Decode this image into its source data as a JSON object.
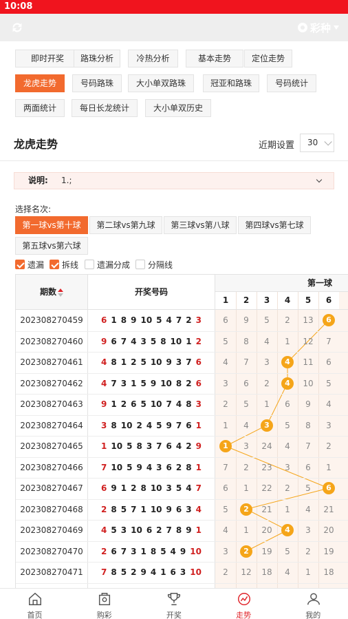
{
  "status": {
    "time": "10:08"
  },
  "header": {
    "lottery": "彩种"
  },
  "tabs": [
    {
      "label": "即时开奖",
      "active": false
    },
    {
      "label": "路珠分析",
      "active": false
    },
    {
      "label": "冷热分析",
      "active": false
    },
    {
      "label": "基本走势",
      "active": false
    },
    {
      "label": "定位走势",
      "active": false
    },
    {
      "label": "龙虎走势",
      "active": true
    },
    {
      "label": "号码路珠",
      "active": false
    },
    {
      "label": "大小单双路珠",
      "active": false
    },
    {
      "label": "冠亚和路珠",
      "active": false
    },
    {
      "label": "号码统计",
      "active": false
    },
    {
      "label": "两面统计",
      "active": false
    },
    {
      "label": "每日长龙统计",
      "active": false
    },
    {
      "label": "大小单双历史",
      "active": false
    }
  ],
  "section": {
    "title": "龙虎走势",
    "period_label": "近期设置",
    "period_value": "30"
  },
  "note": {
    "label": "说明:",
    "text": "1.;"
  },
  "ranks": {
    "label": "选择名次:",
    "items": [
      {
        "label": "第一球vs第十球",
        "active": true
      },
      {
        "label": "第二球vs第九球",
        "active": false
      },
      {
        "label": "第三球vs第八球",
        "active": false
      },
      {
        "label": "第四球vs第七球",
        "active": false
      },
      {
        "label": "第五球vs第六球",
        "active": false
      }
    ]
  },
  "options": [
    {
      "label": "遗漏",
      "checked": true
    },
    {
      "label": "拆线",
      "checked": true
    },
    {
      "label": "遗漏分成",
      "checked": false
    },
    {
      "label": "分隔线",
      "checked": false
    }
  ],
  "nav": [
    {
      "label": "首页",
      "icon": "home-icon",
      "active": false
    },
    {
      "label": "购彩",
      "icon": "lottery-ticket-icon",
      "active": false
    },
    {
      "label": "开奖",
      "icon": "trophy-icon",
      "active": false
    },
    {
      "label": "走势",
      "icon": "trend-icon",
      "active": true
    },
    {
      "label": "我的",
      "icon": "user-icon",
      "active": false
    }
  ],
  "chart_data": {
    "type": "table",
    "title": "第一球",
    "headers": {
      "period": "期数",
      "numbers": "开奖号码"
    },
    "columns": [
      1,
      2,
      3,
      4,
      5,
      6
    ],
    "rows": [
      {
        "period": "202308270459",
        "numbers": [
          6,
          1,
          8,
          9,
          10,
          5,
          4,
          7,
          2,
          3
        ],
        "omission": [
          6,
          9,
          5,
          2,
          13,
          null
        ],
        "hit": 6
      },
      {
        "period": "202308270460",
        "numbers": [
          9,
          6,
          7,
          4,
          3,
          5,
          8,
          10,
          1,
          2
        ],
        "omission": [
          5,
          8,
          4,
          1,
          12,
          7
        ],
        "hit": null
      },
      {
        "period": "202308270461",
        "numbers": [
          4,
          8,
          1,
          2,
          5,
          10,
          9,
          3,
          7,
          6
        ],
        "omission": [
          4,
          7,
          3,
          null,
          11,
          6
        ],
        "hit": 4
      },
      {
        "period": "202308270462",
        "numbers": [
          4,
          7,
          3,
          1,
          5,
          9,
          10,
          8,
          2,
          6
        ],
        "omission": [
          3,
          6,
          2,
          null,
          10,
          5
        ],
        "hit": 4
      },
      {
        "period": "202308270463",
        "numbers": [
          9,
          1,
          2,
          6,
          5,
          10,
          7,
          4,
          8,
          3
        ],
        "omission": [
          2,
          5,
          1,
          6,
          9,
          4
        ],
        "hit": null
      },
      {
        "period": "202308270464",
        "numbers": [
          3,
          8,
          10,
          2,
          4,
          5,
          9,
          7,
          6,
          1
        ],
        "omission": [
          1,
          4,
          null,
          5,
          8,
          3
        ],
        "hit": 3
      },
      {
        "period": "202308270465",
        "numbers": [
          1,
          10,
          5,
          8,
          3,
          7,
          6,
          4,
          2,
          9
        ],
        "omission": [
          null,
          3,
          24,
          4,
          7,
          2
        ],
        "hit": 1
      },
      {
        "period": "202308270466",
        "numbers": [
          7,
          10,
          5,
          9,
          4,
          3,
          6,
          2,
          8,
          1
        ],
        "omission": [
          7,
          2,
          23,
          3,
          6,
          1
        ],
        "hit": null
      },
      {
        "period": "202308270467",
        "numbers": [
          6,
          9,
          1,
          2,
          8,
          10,
          3,
          5,
          4,
          7
        ],
        "omission": [
          6,
          1,
          22,
          2,
          5,
          null
        ],
        "hit": 6
      },
      {
        "period": "202308270468",
        "numbers": [
          2,
          8,
          5,
          7,
          1,
          10,
          9,
          6,
          3,
          4
        ],
        "omission": [
          5,
          null,
          21,
          1,
          4,
          21
        ],
        "hit": 2
      },
      {
        "period": "202308270469",
        "numbers": [
          4,
          5,
          3,
          10,
          6,
          2,
          7,
          8,
          9,
          1
        ],
        "omission": [
          4,
          1,
          20,
          null,
          3,
          20
        ],
        "hit": 4
      },
      {
        "period": "202308270470",
        "numbers": [
          2,
          6,
          7,
          3,
          1,
          8,
          5,
          4,
          9,
          10
        ],
        "omission": [
          3,
          null,
          19,
          5,
          2,
          19
        ],
        "hit": 2
      },
      {
        "period": "202308270471",
        "numbers": [
          7,
          8,
          5,
          2,
          9,
          4,
          1,
          6,
          3,
          10
        ],
        "omission": [
          2,
          12,
          18,
          4,
          1,
          18
        ],
        "hit": null
      }
    ]
  }
}
